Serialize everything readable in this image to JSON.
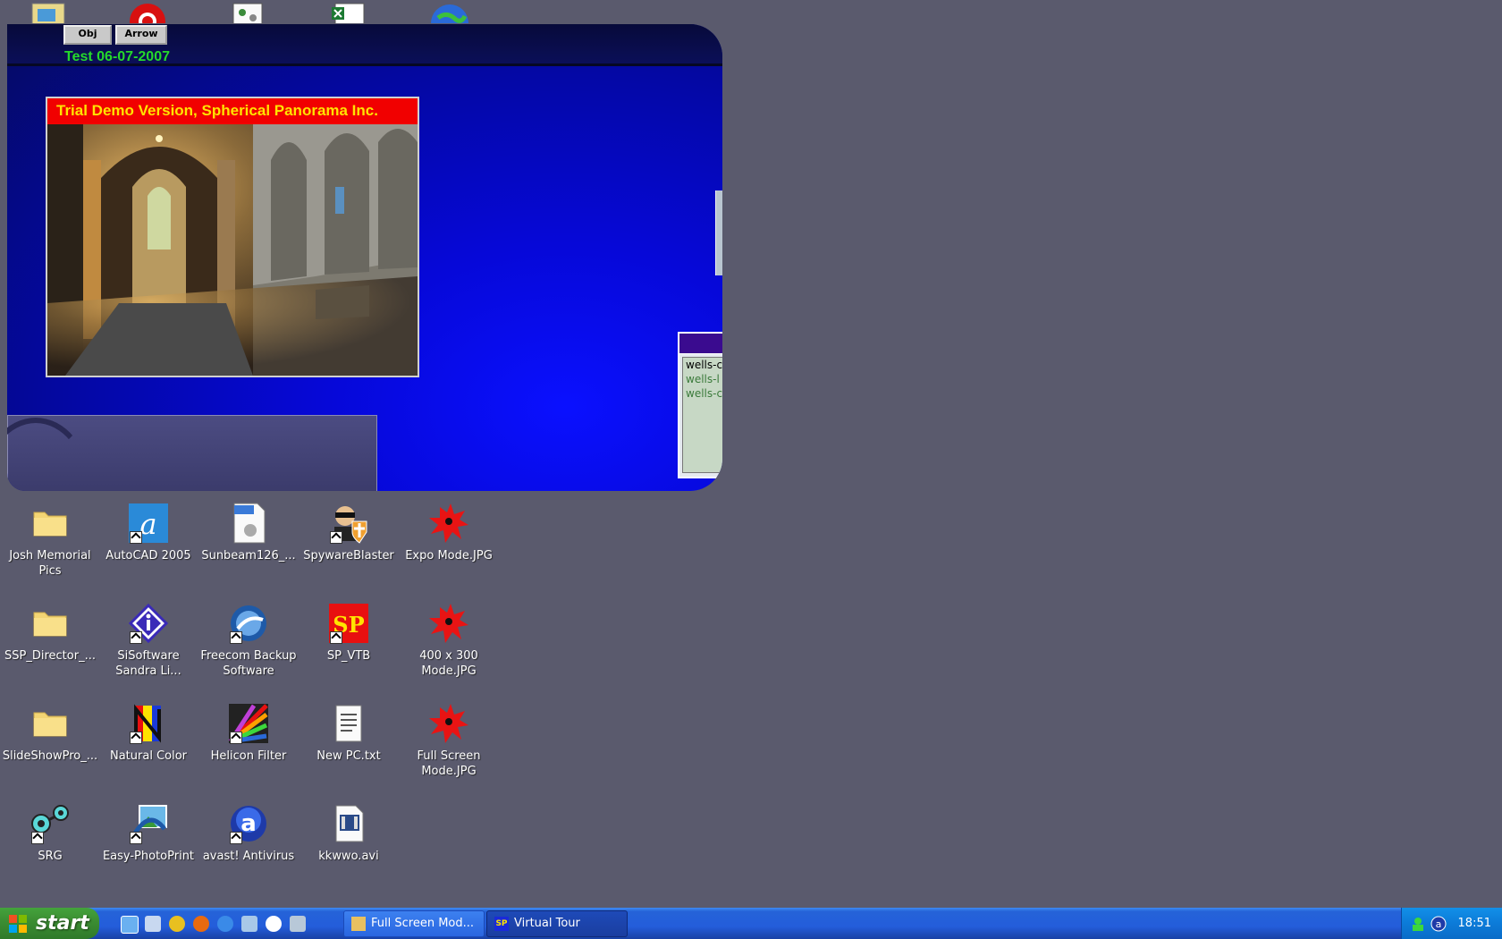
{
  "app": {
    "buttons": {
      "obj": "Obj",
      "arrow": "Arrow"
    },
    "test_label": "Test 06-07-2007",
    "banner": "Trial Demo Version, Spherical Panorama Inc.",
    "list_items": [
      "wells-c",
      "wells-l",
      "wells-c"
    ]
  },
  "desktop_icons": [
    {
      "label": "Josh Memorial Pics",
      "icon": "folder-icon"
    },
    {
      "label": "AutoCAD 2005",
      "icon": "autocad-icon"
    },
    {
      "label": "Sunbeam126_...",
      "icon": "tiff-file-icon"
    },
    {
      "label": "SpywareBlaster",
      "icon": "spywareblaster-icon"
    },
    {
      "label": "Expo Mode.JPG",
      "icon": "jpg-file-icon"
    },
    {
      "label": "SSP_Director_...",
      "icon": "folder-icon"
    },
    {
      "label": "SiSoftware Sandra Li...",
      "icon": "sisoftware-icon"
    },
    {
      "label": "Freecom Backup Software",
      "icon": "freecom-icon"
    },
    {
      "label": "SP_VTB",
      "icon": "sp-vtb-icon"
    },
    {
      "label": "400 x 300 Mode.JPG",
      "icon": "jpg-file-icon"
    },
    {
      "label": "SlideShowPro_...",
      "icon": "folder-icon"
    },
    {
      "label": "Natural Color",
      "icon": "natural-color-icon"
    },
    {
      "label": "Helicon Filter",
      "icon": "helicon-filter-icon"
    },
    {
      "label": "New PC.txt",
      "icon": "txt-file-icon"
    },
    {
      "label": "Full Screen Mode.JPG",
      "icon": "jpg-file-icon"
    },
    {
      "label": "SRG",
      "icon": "srg-icon"
    },
    {
      "label": "Easy-PhotoPrint",
      "icon": "easy-photoprint-icon"
    },
    {
      "label": "avast! Antivirus",
      "icon": "avast-icon"
    },
    {
      "label": "kkwwo.avi",
      "icon": "avi-file-icon"
    }
  ],
  "taskbar": {
    "start_label": "start",
    "tasks": [
      "Full Screen Mod...",
      "Virtual Tour"
    ],
    "clock": "18:51",
    "sp_badge": "SP"
  },
  "colors": {
    "desktop": "#5a5a6d",
    "app_blue": "#0608d8",
    "banner_red": "#f10000",
    "banner_text": "#ffe400",
    "test_green": "#25d82b"
  }
}
